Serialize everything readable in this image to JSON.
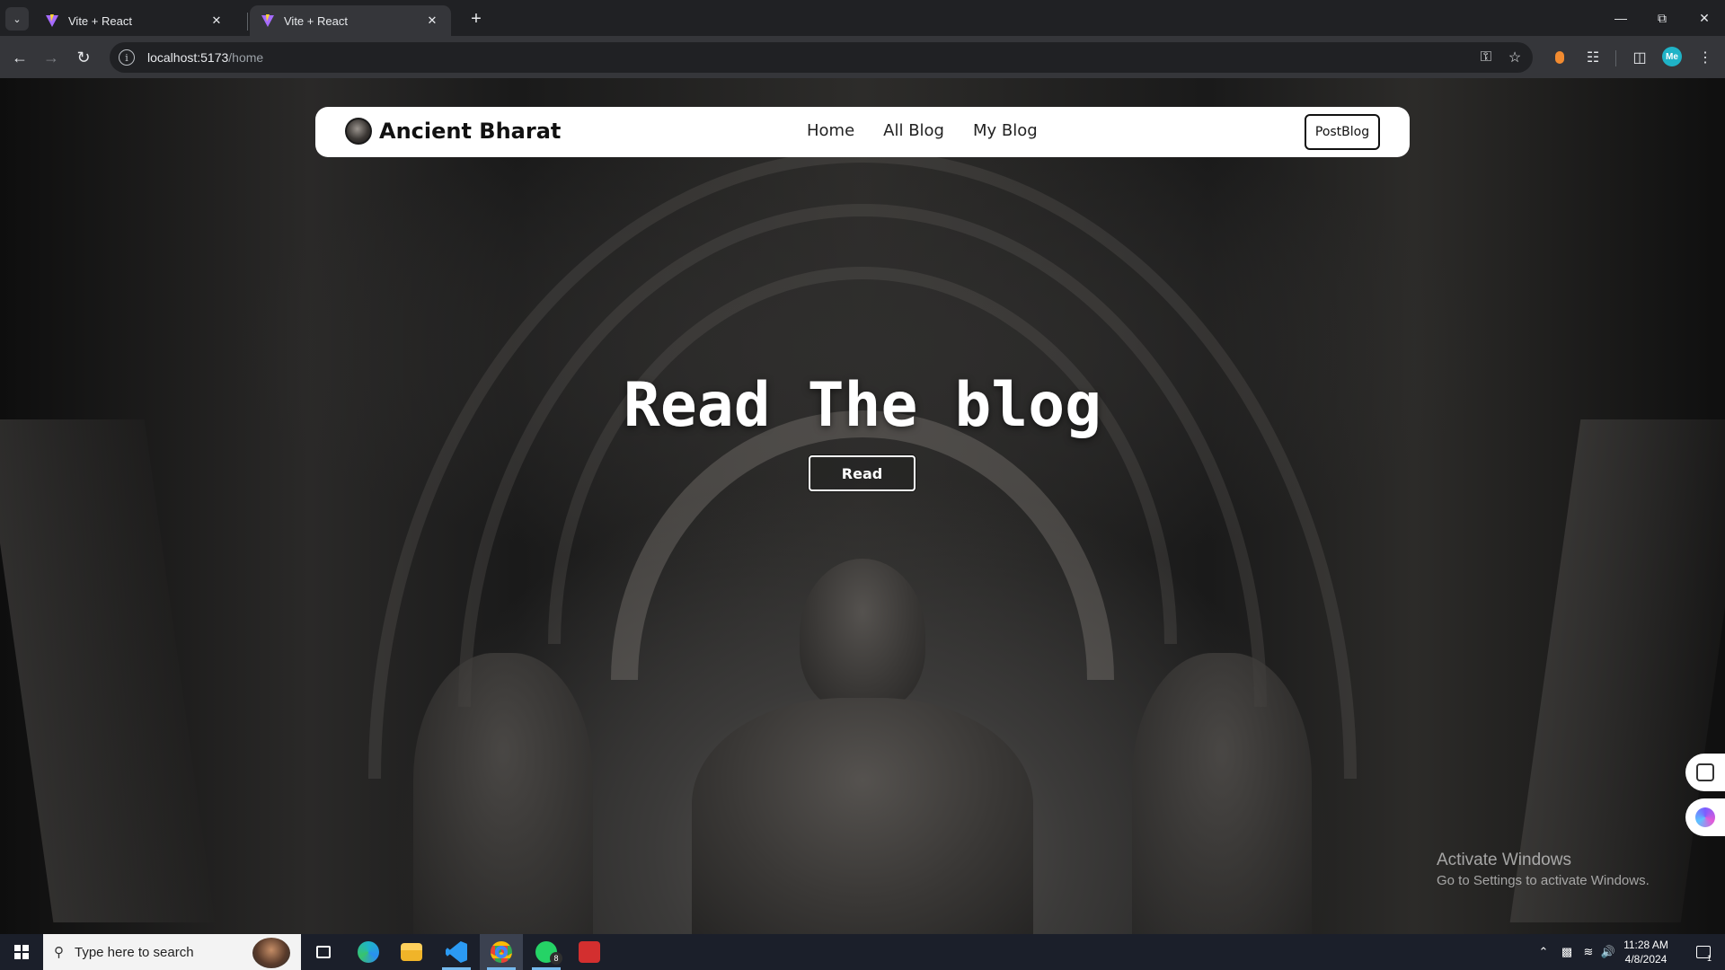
{
  "browser": {
    "tabs": [
      {
        "title": "Vite + React",
        "active": false
      },
      {
        "title": "Vite + React",
        "active": true
      }
    ],
    "url_host": "localhost:5173",
    "url_path": "/home",
    "profile_initials": "Me"
  },
  "site": {
    "brand": "Ancient Bharat",
    "nav": [
      "Home",
      "All Blog",
      "My Blog"
    ],
    "post_button": "PostBlog",
    "hero_title": "Read The blog",
    "read_button": "Read"
  },
  "watermark": {
    "line1": "Activate Windows",
    "line2": "Go to Settings to activate Windows."
  },
  "taskbar": {
    "search_placeholder": "Type here to search",
    "whatsapp_badge": "8",
    "time": "11:28 AM",
    "date": "4/8/2024",
    "notification_count": "1"
  },
  "colors": {
    "accent": "#76b9ed",
    "chrome_dark": "#202124",
    "chrome_toolbar": "#35363a"
  }
}
